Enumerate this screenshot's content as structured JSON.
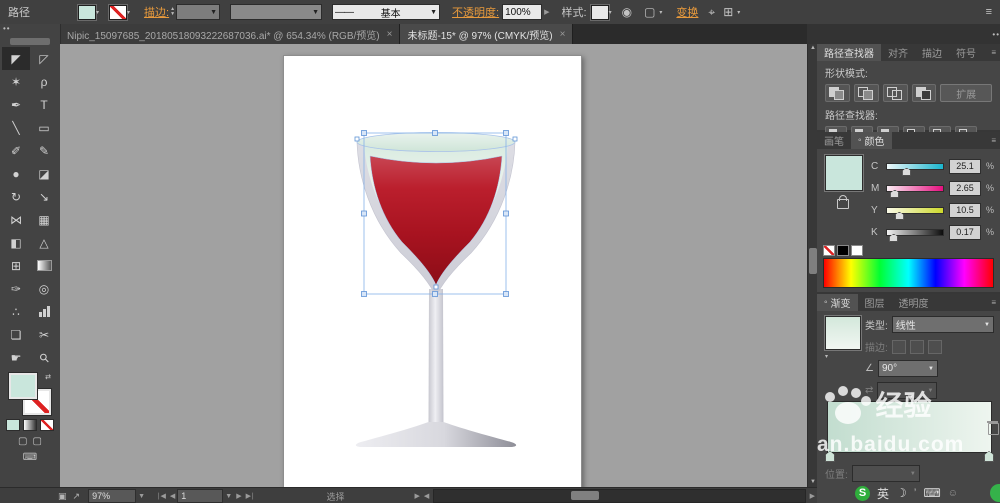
{
  "control_bar": {
    "object_label": "路径",
    "stroke_label": "描边:",
    "brush_name": "基本",
    "opacity_label": "不透明度:",
    "opacity_value": "100%",
    "style_label": "样式:",
    "transform_label": "变换"
  },
  "document_tabs": [
    {
      "title": "Nipic_15097685_20180518093222687036.ai* @ 654.34% (RGB/预览)",
      "close": "×"
    },
    {
      "title": "未标题-15* @ 97% (CMYK/预览)",
      "close": "×"
    }
  ],
  "tools": [
    {
      "name": "selection-tool",
      "glyph": "◤",
      "active": true
    },
    {
      "name": "direct-selection-tool",
      "glyph": "◸"
    },
    {
      "name": "magic-wand-tool",
      "glyph": "✶"
    },
    {
      "name": "lasso-tool",
      "glyph": "ρ"
    },
    {
      "name": "pen-tool",
      "glyph": "✒"
    },
    {
      "name": "type-tool",
      "glyph": "T"
    },
    {
      "name": "line-segment-tool",
      "glyph": "╲"
    },
    {
      "name": "rectangle-tool",
      "glyph": "▭"
    },
    {
      "name": "paintbrush-tool",
      "glyph": "✐"
    },
    {
      "name": "pencil-tool",
      "glyph": "✎"
    },
    {
      "name": "blob-brush-tool",
      "glyph": "●"
    },
    {
      "name": "eraser-tool",
      "glyph": "◪"
    },
    {
      "name": "rotate-tool",
      "glyph": "↻"
    },
    {
      "name": "scale-tool",
      "glyph": "↘"
    },
    {
      "name": "width-tool",
      "glyph": "⋈"
    },
    {
      "name": "free-transform-tool",
      "glyph": "▦"
    },
    {
      "name": "shape-builder-tool",
      "glyph": "◧"
    },
    {
      "name": "perspective-grid-tool",
      "glyph": "△"
    },
    {
      "name": "mesh-tool",
      "glyph": "⊞"
    },
    {
      "name": "gradient-tool",
      "glyph": "",
      "special": "gradient"
    },
    {
      "name": "eyedropper-tool",
      "glyph": "✑"
    },
    {
      "name": "blend-tool",
      "glyph": "◎"
    },
    {
      "name": "symbol-sprayer-tool",
      "glyph": "∴"
    },
    {
      "name": "column-graph-tool",
      "glyph": "",
      "special": "bars"
    },
    {
      "name": "artboard-tool",
      "glyph": "❏"
    },
    {
      "name": "slice-tool",
      "glyph": "✂"
    },
    {
      "name": "hand-tool",
      "glyph": "☛"
    },
    {
      "name": "zoom-tool",
      "glyph": "⚲"
    }
  ],
  "pathfinder_panel": {
    "tabs": [
      "路径查找器",
      "对齐",
      "描边",
      "符号"
    ],
    "shape_modes_label": "形状模式:",
    "expand_label": "扩展",
    "pathfinder_label": "路径查找器:"
  },
  "color_panel": {
    "tabs": [
      "画笔",
      "颜色"
    ],
    "channels": [
      {
        "label": "C",
        "value": "25.1",
        "left": "#eef8fa",
        "right": "#1ab5cd",
        "pos": 27
      },
      {
        "label": "M",
        "value": "2.65",
        "left": "#faeef4",
        "right": "#e50f7e",
        "pos": 6
      },
      {
        "label": "Y",
        "value": "10.5",
        "left": "#fafae8",
        "right": "#cdd92b",
        "pos": 14
      },
      {
        "label": "K",
        "value": "0.17",
        "left": "#f2f2f2",
        "right": "#0d0d0d",
        "pos": 4
      }
    ],
    "percent": "%",
    "fill_color": "#c9e6dc"
  },
  "gradient_panel": {
    "tabs": [
      "渐变",
      "图层",
      "透明度"
    ],
    "type_label": "类型:",
    "type_value": "线性",
    "stroke_label": "描边:",
    "angle_value": "90°",
    "position_label": "位置:"
  },
  "status_bar": {
    "zoom_value": "97%",
    "artboard_number": "1",
    "tool_name": "选择"
  },
  "watermark": {
    "brand": "经验",
    "url": "an.baidu.com"
  },
  "ime_bar": {
    "logo": "S",
    "lang": "英"
  },
  "icons": {
    "collapse_dots": "••",
    "menu": "≡",
    "dropdown": "▾",
    "up": "▲",
    "down": "▼",
    "left": "◀",
    "right": "▶",
    "first": "∣◀",
    "last": "▶∣",
    "live_dot": "◦",
    "globe": "◉",
    "dashed_box": "▢",
    "angle": "∠",
    "swap": "⇄",
    "moon": "☽",
    "keyboard": "⌨",
    "person": "☺",
    "tick": "’",
    "status_1": "▣",
    "status_2": "↗",
    "align_1": "⌖",
    "align_2": "⊞"
  },
  "artwork": {
    "wine_color": "#b01420",
    "glass_color": "#d6d6dc",
    "rim_color": "#d9ece2",
    "stem_color": "#d8d8dd"
  }
}
